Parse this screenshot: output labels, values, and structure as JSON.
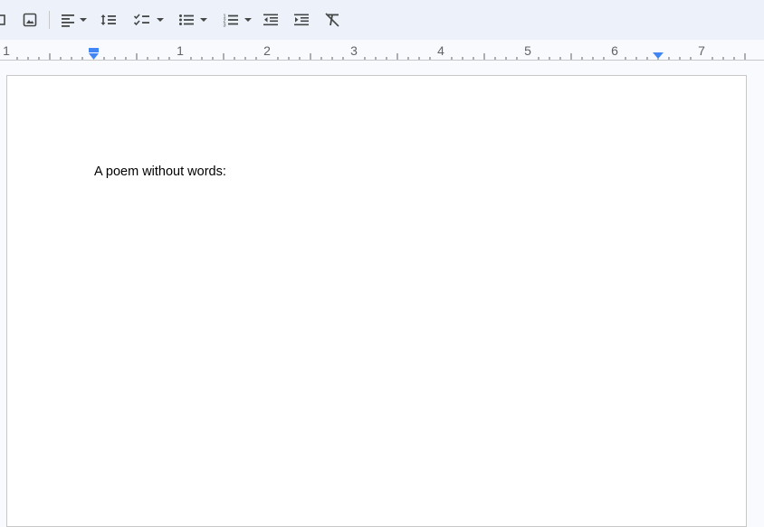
{
  "toolbar": {
    "buttons": [
      {
        "name": "checklist-partial-icon"
      },
      {
        "name": "insert-image-icon"
      },
      {
        "name": "align-left-icon",
        "dropdown": true
      },
      {
        "name": "line-spacing-icon"
      },
      {
        "name": "checklist-icon",
        "dropdown": true
      },
      {
        "name": "bulleted-list-icon",
        "dropdown": true
      },
      {
        "name": "numbered-list-icon",
        "dropdown": true
      },
      {
        "name": "decrease-indent-icon"
      },
      {
        "name": "increase-indent-icon"
      },
      {
        "name": "clear-formatting-icon"
      }
    ]
  },
  "ruler": {
    "numbers": [
      "1",
      "1",
      "2",
      "3",
      "4",
      "5",
      "6",
      "7"
    ],
    "accent_color": "#4285f4"
  },
  "document": {
    "lines": [
      "A poem without words:"
    ]
  }
}
